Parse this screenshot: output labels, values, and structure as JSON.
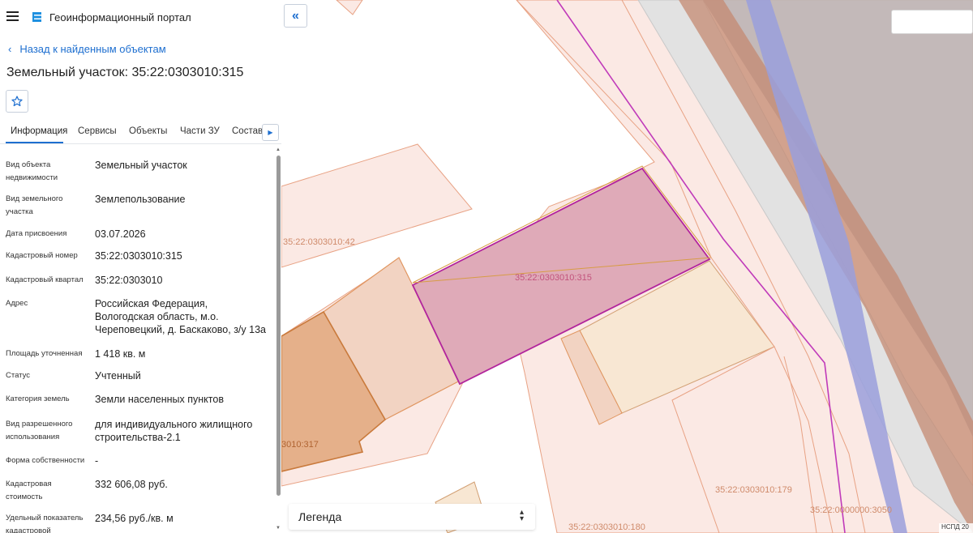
{
  "header": {
    "app_title": "Геоинформационный портал",
    "menu_icon": "menu-icon",
    "logo_icon": "logo-icon"
  },
  "nav": {
    "back_label": "Назад к найденным объектам"
  },
  "object": {
    "title": "Земельный участок: 35:22:0303010:315"
  },
  "tabs": [
    {
      "label": "Информация",
      "active": true
    },
    {
      "label": "Сервисы",
      "active": false
    },
    {
      "label": "Объекты",
      "active": false
    },
    {
      "label": "Части ЗУ",
      "active": false
    },
    {
      "label": "Состав",
      "active": false
    }
  ],
  "info_rows": [
    {
      "label": "Вид объекта недвижимости",
      "value": "Земельный участок"
    },
    {
      "label": "Вид земельного участка",
      "value": "Землепользование"
    },
    {
      "label": "Дата присвоения",
      "value": "03.07.2026"
    },
    {
      "label": "Кадастровый номер",
      "value": "35:22:0303010:315"
    },
    {
      "label": "Кадастровый квартал",
      "value": "35:22:0303010"
    },
    {
      "label": "Адрес",
      "value": "Российская Федерация, Вологодская область, м.о. Череповецкий, д. Баскаково, з/у 13а"
    },
    {
      "label": "Площадь уточненная",
      "value": "1 418 кв. м"
    },
    {
      "label": "Статус",
      "value": "Учтенный"
    },
    {
      "label": "Категория земель",
      "value": "Земли населенных пунктов"
    },
    {
      "label": "Вид разрешенного использования",
      "value": "для индивидуального жилищного строительства-2.1"
    },
    {
      "label": "Форма собственности",
      "value": "-"
    },
    {
      "label": "Кадастровая стоимость",
      "value": "332 606,08 руб."
    },
    {
      "label": "Удельный показатель кадастровой",
      "value": "234,56 руб./кв. м"
    }
  ],
  "map": {
    "collapse_icon": "double-chevron-left-icon",
    "labels": {
      "selected": "35:22:0303010:315",
      "parcel_42": "35:22:0303010:42",
      "parcel_317": "3010:317",
      "parcel_179": "35:22:0303010:179",
      "parcel_180": "35:22:0303010:180",
      "parcel_3050": "35:22:0000000:3050"
    },
    "legend_label": "Легенда",
    "attribution": "НСПД 20",
    "colors": {
      "selected_fill": "#dfaab8",
      "selected_stroke": "#b2249c",
      "parcel_fill": "#fbe9e4",
      "parcel_stroke": "#e8a284",
      "label_color": "#cf8a6a",
      "selected_label": "#c2537c",
      "road_gray": "#bcb4b4",
      "road_blue": "#9a9fdc",
      "accent": "#1e6fd0"
    }
  }
}
